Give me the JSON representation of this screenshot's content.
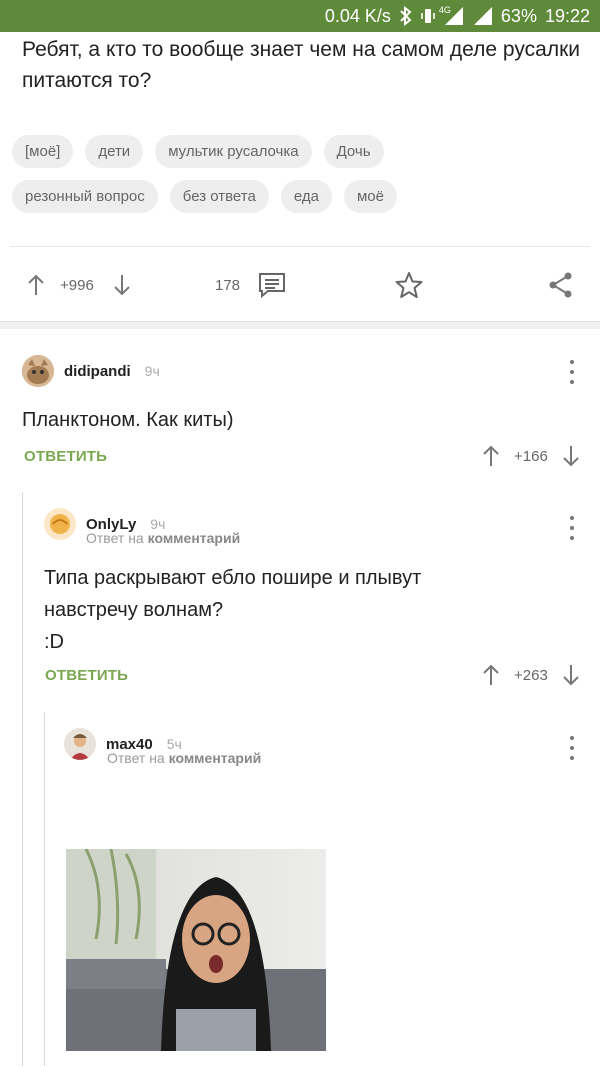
{
  "status_bar": {
    "speed": "0.04 K/s",
    "network": "4G",
    "battery": "63%",
    "time": "19:22",
    "icons": [
      "bluetooth-icon",
      "vibrate-icon",
      "signal-4g-icon",
      "signal-icon"
    ]
  },
  "post": {
    "text": "Ребят, а кто то вообще знает чем на самом деле русалки питаются то?",
    "tags_row1": [
      "[моё]",
      "дети",
      "мультик русалочка",
      "Дочь"
    ],
    "tags_row2": [
      "резонный вопрос",
      "без ответа",
      "еда",
      "моё"
    ],
    "rating": "+996",
    "comments_count": "178"
  },
  "comments": [
    {
      "user": "didipandi",
      "time": "9ч",
      "text": "Планктоном. Как киты)",
      "reply_label": "ОТВЕТИТЬ",
      "rating": "+166"
    },
    {
      "user": "OnlyLy",
      "time": "9ч",
      "sub_prefix": "Ответ на",
      "sub_link": "комментарий",
      "text_line1": "Типа раскрывают ебло пошире и плывут",
      "text_line2": "навстречу волнам?",
      "text_line3": ":D",
      "reply_label": "ОТВЕТИТЬ",
      "rating": "+263"
    },
    {
      "user": "max40",
      "time": "5ч",
      "sub_prefix": "Ответ на",
      "sub_link": "комментарий"
    }
  ],
  "colors": {
    "status_bar": "#5f8a3a",
    "reply_green": "#7aa850"
  }
}
